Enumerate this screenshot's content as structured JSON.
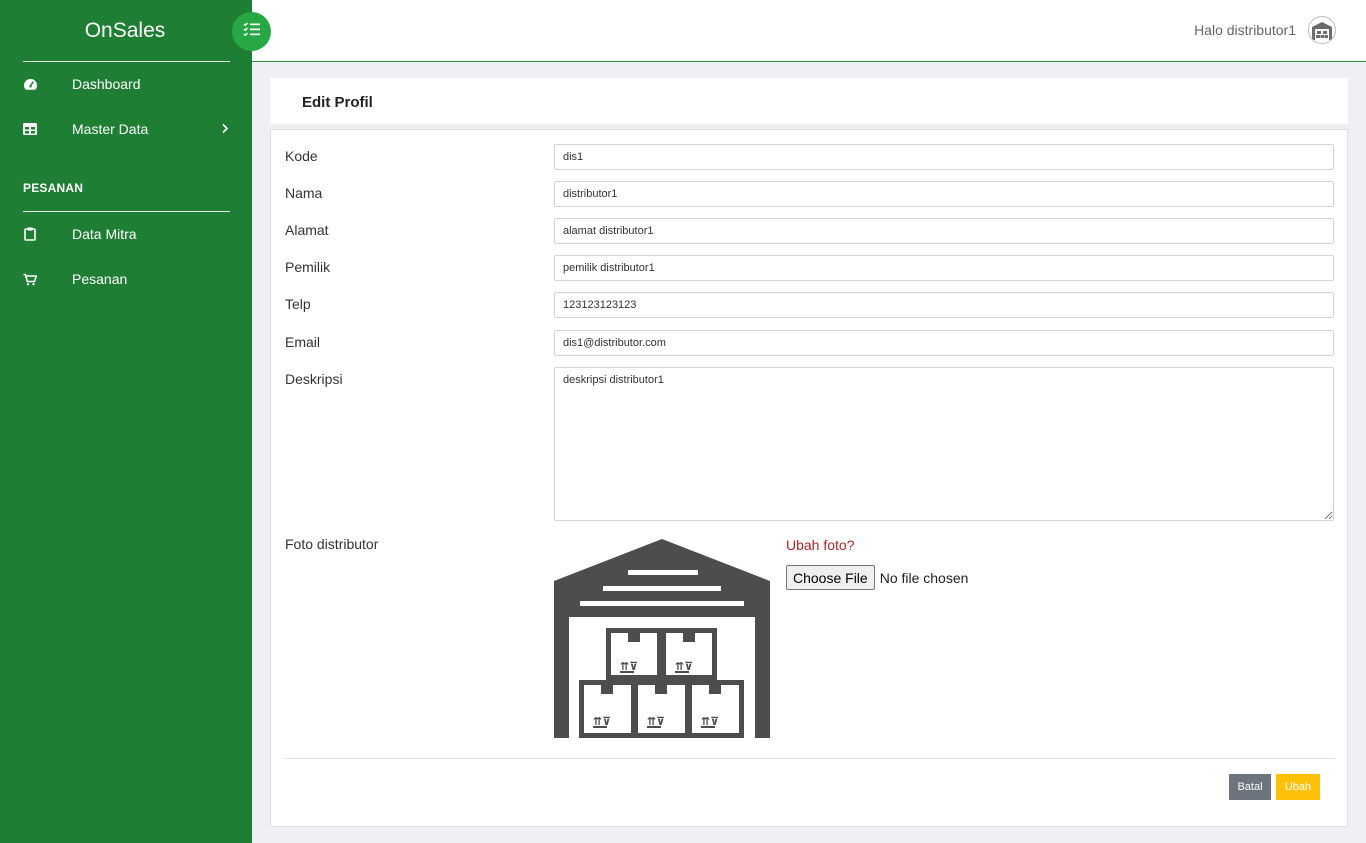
{
  "app": {
    "brand": "OnSales"
  },
  "sidebar": {
    "items": [
      {
        "label": "Dashboard",
        "icon": "tachometer-icon"
      },
      {
        "label": "Master Data",
        "icon": "table-icon",
        "has_submenu": true
      }
    ],
    "section_title": "PESANAN",
    "section_items": [
      {
        "label": "Data Mitra",
        "icon": "clipboard-icon"
      },
      {
        "label": "Pesanan",
        "icon": "cart-icon"
      }
    ]
  },
  "topbar": {
    "greeting": "Halo distributor1"
  },
  "page": {
    "title": "Edit Profil"
  },
  "form": {
    "kode": {
      "label": "Kode",
      "value": "dis1"
    },
    "nama": {
      "label": "Nama",
      "value": "distributor1"
    },
    "alamat": {
      "label": "Alamat",
      "value": "alamat distributor1"
    },
    "pemilik": {
      "label": "Pemilik",
      "value": "pemilik distributor1"
    },
    "telp": {
      "label": "Telp",
      "value": "123123123123"
    },
    "email": {
      "label": "Email",
      "value": "dis1@distributor.com"
    },
    "deskripsi": {
      "label": "Deskripsi",
      "value": "deskripsi distributor1"
    },
    "foto": {
      "label": "Foto distributor",
      "change_link": "Ubah foto?",
      "choose_button": "Choose File",
      "file_status": "No file chosen"
    }
  },
  "actions": {
    "cancel": "Batal",
    "submit": "Ubah"
  },
  "colors": {
    "sidebar": "#1e7e34",
    "toggle": "#28a745",
    "cancel": "#6c757d",
    "submit": "#ffc107",
    "link": "#a5282c"
  }
}
